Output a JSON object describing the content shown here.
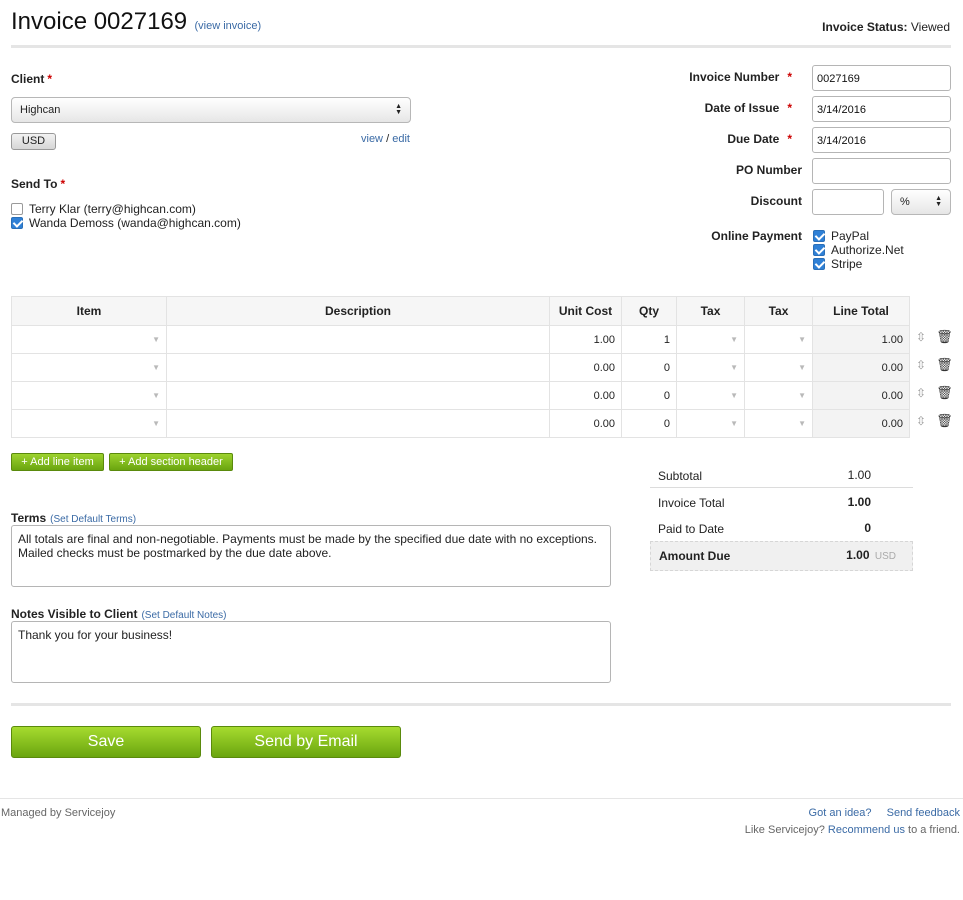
{
  "header": {
    "title": "Invoice 0027169",
    "view_invoice": "(view invoice)",
    "status_label": "Invoice Status:",
    "status_value": "Viewed"
  },
  "client": {
    "label": "Client",
    "required": "*",
    "selected": "Highcan",
    "currency": "USD",
    "view": "view",
    "separator": "/",
    "edit": "edit"
  },
  "send_to": {
    "label": "Send To",
    "required": "*",
    "recipients": [
      {
        "text": "Terry Klar (terry@highcan.com)",
        "checked": false
      },
      {
        "text": "Wanda Demoss (wanda@highcan.com)",
        "checked": true
      }
    ]
  },
  "details": {
    "invoice_number_label": "Invoice Number",
    "invoice_number": "0027169",
    "date_of_issue_label": "Date of Issue",
    "date_of_issue": "3/14/2016",
    "due_date_label": "Due Date",
    "due_date": "3/14/2016",
    "po_number_label": "PO Number",
    "po_number": "",
    "discount_label": "Discount",
    "discount": "",
    "discount_type": "%",
    "required": "*"
  },
  "online_payment": {
    "label": "Online Payment",
    "methods": [
      {
        "name": "PayPal",
        "checked": true
      },
      {
        "name": "Authorize.Net",
        "checked": true
      },
      {
        "name": "Stripe",
        "checked": true
      }
    ]
  },
  "items_table": {
    "headers": [
      "Item",
      "Description",
      "Unit Cost",
      "Qty",
      "Tax",
      "Tax",
      "Line Total"
    ],
    "rows": [
      {
        "item": "",
        "description": "",
        "unit_cost": "1.00",
        "qty": "1",
        "tax1": "",
        "tax2": "",
        "line_total": "1.00"
      },
      {
        "item": "",
        "description": "",
        "unit_cost": "0.00",
        "qty": "0",
        "tax1": "",
        "tax2": "",
        "line_total": "0.00"
      },
      {
        "item": "",
        "description": "",
        "unit_cost": "0.00",
        "qty": "0",
        "tax1": "",
        "tax2": "",
        "line_total": "0.00"
      },
      {
        "item": "",
        "description": "",
        "unit_cost": "0.00",
        "qty": "0",
        "tax1": "",
        "tax2": "",
        "line_total": "0.00"
      }
    ],
    "add_line_item": "+ Add line item",
    "add_section_header": "+ Add section header"
  },
  "totals": {
    "subtotal_label": "Subtotal",
    "subtotal": "1.00",
    "invoice_total_label": "Invoice Total",
    "invoice_total": "1.00",
    "paid_label": "Paid to Date",
    "paid": "0",
    "amount_due_label": "Amount Due",
    "amount_due": "1.00",
    "currency": "USD"
  },
  "terms": {
    "label": "Terms",
    "set_default": "(Set Default Terms)",
    "text": "All totals are final and non-negotiable. Payments must be made by the specified due date with no exceptions. Mailed checks must be postmarked by the due date above."
  },
  "notes": {
    "label": "Notes Visible to Client",
    "set_default": "(Set Default Notes)",
    "text": "Thank you for your business!"
  },
  "actions": {
    "save": "Save",
    "send_email": "Send by Email"
  },
  "footer": {
    "managed_by": "Managed by Servicejoy",
    "got_idea": "Got an idea?",
    "send_feedback": "Send feedback",
    "like_prefix": "Like Servicejoy?",
    "recommend": "Recommend us",
    "like_suffix": "to a friend."
  }
}
